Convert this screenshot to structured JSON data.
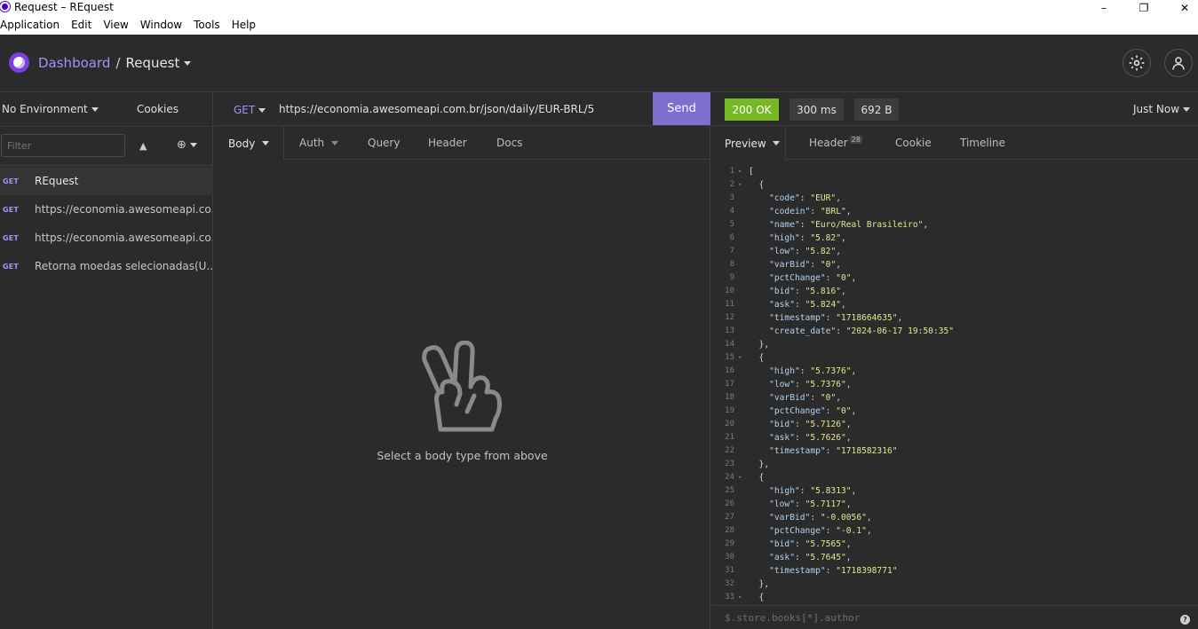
{
  "window": {
    "title": "Request – REquest",
    "controls": [
      "–",
      "❐",
      "✕"
    ]
  },
  "menubar": [
    "Application",
    "Edit",
    "View",
    "Window",
    "Tools",
    "Help"
  ],
  "header": {
    "dashboard": "Dashboard",
    "separator": "/",
    "current": "Request"
  },
  "sidebar": {
    "environment": "No Environment",
    "cookies": "Cookies",
    "filter_placeholder": "Filter",
    "items": [
      {
        "method": "GET",
        "name": "REquest"
      },
      {
        "method": "GET",
        "name": "https://economia.awesomeapi.co..."
      },
      {
        "method": "GET",
        "name": "https://economia.awesomeapi.co..."
      },
      {
        "method": "GET",
        "name": "Retorna moedas selecionadas(U..."
      }
    ]
  },
  "request": {
    "method": "GET",
    "url": "https://economia.awesomeapi.com.br/json/daily/EUR-BRL/5",
    "send": "Send",
    "tabs": [
      "Body",
      "Auth",
      "Query",
      "Header",
      "Docs"
    ],
    "empty_message": "Select a body type from above"
  },
  "response": {
    "status": "200 OK",
    "time": "300 ms",
    "size": "692 B",
    "when": "Just Now",
    "tabs": {
      "preview": "Preview",
      "header": "Header",
      "header_count": "28",
      "cookie": "Cookie",
      "timeline": "Timeline"
    },
    "filter_placeholder": "$.store.books[*].author",
    "help": "?",
    "lines": [
      "[",
      "  {",
      "    \"code\": \"EUR\",",
      "    \"codein\": \"BRL\",",
      "    \"name\": \"Euro/Real Brasileiro\",",
      "    \"high\": \"5.82\",",
      "    \"low\": \"5.82\",",
      "    \"varBid\": \"0\",",
      "    \"pctChange\": \"0\",",
      "    \"bid\": \"5.816\",",
      "    \"ask\": \"5.824\",",
      "    \"timestamp\": \"1718664635\",",
      "    \"create_date\": \"2024-06-17 19:50:35\"",
      "  },",
      "  {",
      "    \"high\": \"5.7376\",",
      "    \"low\": \"5.7376\",",
      "    \"varBid\": \"0\",",
      "    \"pctChange\": \"0\",",
      "    \"bid\": \"5.7126\",",
      "    \"ask\": \"5.7626\",",
      "    \"timestamp\": \"1718582316\"",
      "  },",
      "  {",
      "    \"high\": \"5.8313\",",
      "    \"low\": \"5.7117\",",
      "    \"varBid\": \"-0.0056\",",
      "    \"pctChange\": \"-0.1\",",
      "    \"bid\": \"5.7565\",",
      "    \"ask\": \"5.7645\",",
      "    \"timestamp\": \"1718398771\"",
      "  },",
      "  {"
    ],
    "foldable_lines": [
      1,
      2,
      15,
      24,
      33
    ]
  },
  "colors": {
    "accent": "#7e6fcf",
    "status_ok": "#75ba24",
    "json_key": "#b5d2ee",
    "json_string": "#e7e68f"
  }
}
